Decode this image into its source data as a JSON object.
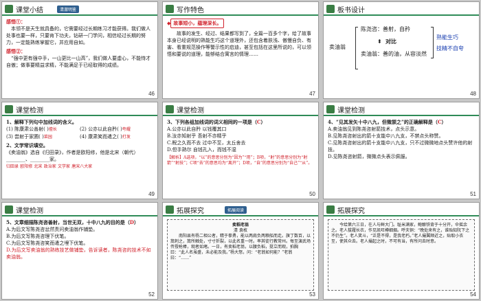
{
  "slides": [
    {
      "num": "46",
      "title": "课堂小结",
      "badge": "清澈明鉴",
      "p1_head": "感悟①：",
      "p1": "本领不是天生就具备的，它需要经过长期练习才能获得。我们做人处事也要一样，只要肯下功夫，钻研一门学问，相信经过长期的努力，一定能熟练掌握它，并应用自如。",
      "p2_head": "感悟②：",
      "p2": "“强中更有强中手，一山更比一山高”，我们做人要虚心，不能恃才自傲；做事要精益求精，不能满足于已经取得的成绩。"
    },
    {
      "num": "47",
      "title": "写作特色",
      "point": "故事短小，蕴理深长。",
      "text": "故事的发生、经过、结果都写到了，全篇一百多个字，给了故事本身已经说明的熟能生巧这个道理外，还包含着肤浅、傲慢自负、有害、看重规范操作等警示性的启迪，甚至包括在这里所说的，可以领悟和要说的道理，能够结合寓言的情理……"
    },
    {
      "num": "48",
      "title": "板书设计",
      "center": "卖油翁",
      "top_line": "陈尧咨：善射，自矜",
      "vs": "对比",
      "bottom_line": "卖油翁：善的油，从容淡然",
      "result1": "熟能生巧",
      "result2": "技精不自夸"
    },
    {
      "num": "49",
      "title": "课堂检测",
      "q1": "1、解释下列句中加线词的含义。",
      "items": [
        "(1) 陈康肃公善射(     )",
        "(2) 公亦以此自矜(     )",
        "(3) 尝射于家圃(     )",
        "(4) 康肃笑而遣之(     )"
      ],
      "answers": [
        "擅长",
        "夸耀",
        "菜园",
        "打发"
      ],
      "q2": "2、文学常识填空。",
      "q2text": "《卖油翁》选自《归田录》，作者是欧阳修，他是北宋（朝代）________、________家。",
      "q2ans1": "归田录",
      "q2ans2": "欧阳修",
      "q2ans3": "北宋",
      "q2ans4": "政治家",
      "q2ans5": "文学家",
      "q2ans6": "唐宋八大家"
    },
    {
      "num": "50",
      "title": "课堂检测",
      "q": "3、下列各组加线词的词义相同的一项是（",
      "q_ans": "C",
      "q_end": "）",
      "opts": [
        "A.公亦以此自矜        以钱覆其口",
        "B.汝亦知射乎          吾射不亦精乎",
        "C.睨之久而不去        过中不至，太丘舍去",
        "D.但手熟尔            自钱孔入，而钱不湿"
      ],
      "analysis": "【解析】A选项，“以”的意思分别为“因为”“用”；B项，“射”的意思分别为“射箭”“射技”；C项“去”的意思均为“离开”；D项，“自”的意思分别为“自己”“从”。"
    },
    {
      "num": "51",
      "title": "课堂检测",
      "q": "4、“见其发矢十中八九，但微颔之”的正确解释是（",
      "q_ans": "C",
      "q_end": "）",
      "opts": [
        "A.卖油翁见到陈尧咨射箭技术，点头示意。",
        "B.见陈尧咨射出的箭十支能中八九支，不禁点头称赞。",
        "C.见陈尧咨射出的箭十支能中八九支，只不过微微地点头赞许他的射技。",
        "D.见陈尧咨射箭，微微点头表示佩服。"
      ]
    },
    {
      "num": "52",
      "title": "课堂检测",
      "q": "5、文章细描陈尧咨善射，当世无双，十中八九的目的是（",
      "q_ans": "D",
      "q_end": "）",
      "opts": [
        "A.为后文写陈尧咨忿然责问卖油翁作铺垫。",
        "B.为后文写陈尧咨理下伏笔。",
        "C.为后文写陈尧咨笑而遣之埋下伏笔。",
        "D.为后文写卖油翁的熟练技艺做铺垫，告诉读者，陈尧咨的技术不如卖油翁。"
      ]
    },
    {
      "num": "53",
      "title": "拓展探究",
      "badge": "拓展阅读",
      "story_title": "卖稻老翁",
      "author": "清  袁枚",
      "text": "南阳县有杨二相公者，精于拳勇，能以两肩负两粮船而走。旗丁数百，以篙刺之，篙所触处，寸寸折裂，以此名重一时。率其徒行教常州。每至演武场传授枪棒，观者如堵。一日，有卖稻老翁，以腰负稻，挺立而观，拍胸曰：“此人名虽盛，未必能及我。”杨大怒，问：“老翁如何能？”老翁曰：“……”"
    },
    {
      "num": "54",
      "title": "拓展探究",
      "text": "今给第六三日，在人与鲜大门。耻米满家，鲍酿铁背于十分开，伞摇余之。老人拔履长衣，作见凯旺樽细烟。呼夫铜：“晚处来有之，谁贻知阮下之不仍生”。老人笑斗，“正是不得，是我老朽。”老人撮翼顺近之，贴取小衣至，使其众去。老人撮起之时，不可有当，有所问去时意。"
    }
  ]
}
